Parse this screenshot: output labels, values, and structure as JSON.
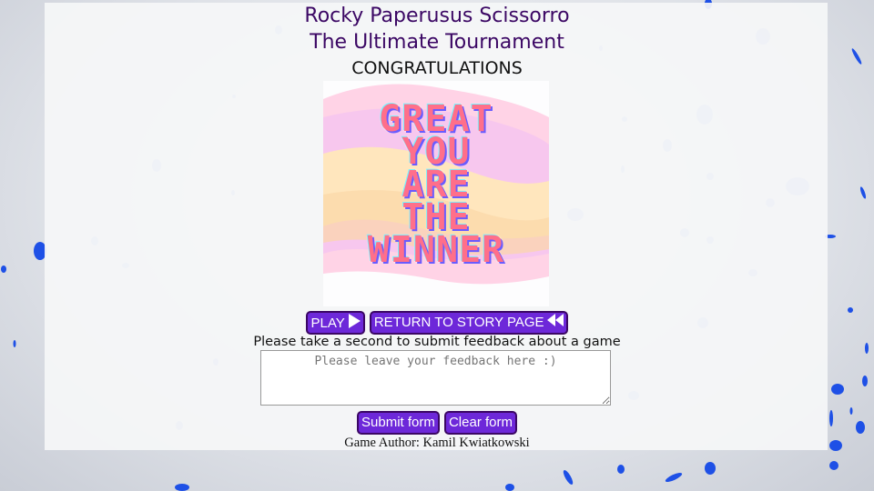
{
  "header": {
    "title": "Rocky Paperusus Scissorro",
    "subtitle": "The Ultimate Tournament",
    "status": "CONGRATULATIONS"
  },
  "result_image": {
    "lines": [
      "GREAT",
      "YOU",
      "ARE",
      "THE",
      "WINNER"
    ]
  },
  "nav": {
    "play_label": "PLAY",
    "play_icon": "play-icon",
    "return_label": "RETURN TO STORY PAGE",
    "return_icon": "rewind-icon"
  },
  "feedback": {
    "label": "Please take a second to submit feedback about a game",
    "placeholder": "Please leave your feedback here :)",
    "value": ""
  },
  "form_buttons": {
    "submit_label": "Submit form",
    "clear_label": "Clear form"
  },
  "footer": {
    "author": "Game Author: Kamil Kwiatkowski"
  },
  "colors": {
    "accent": "#6d28d9",
    "title": "#3b0764",
    "confetti": "#1e50e6"
  }
}
